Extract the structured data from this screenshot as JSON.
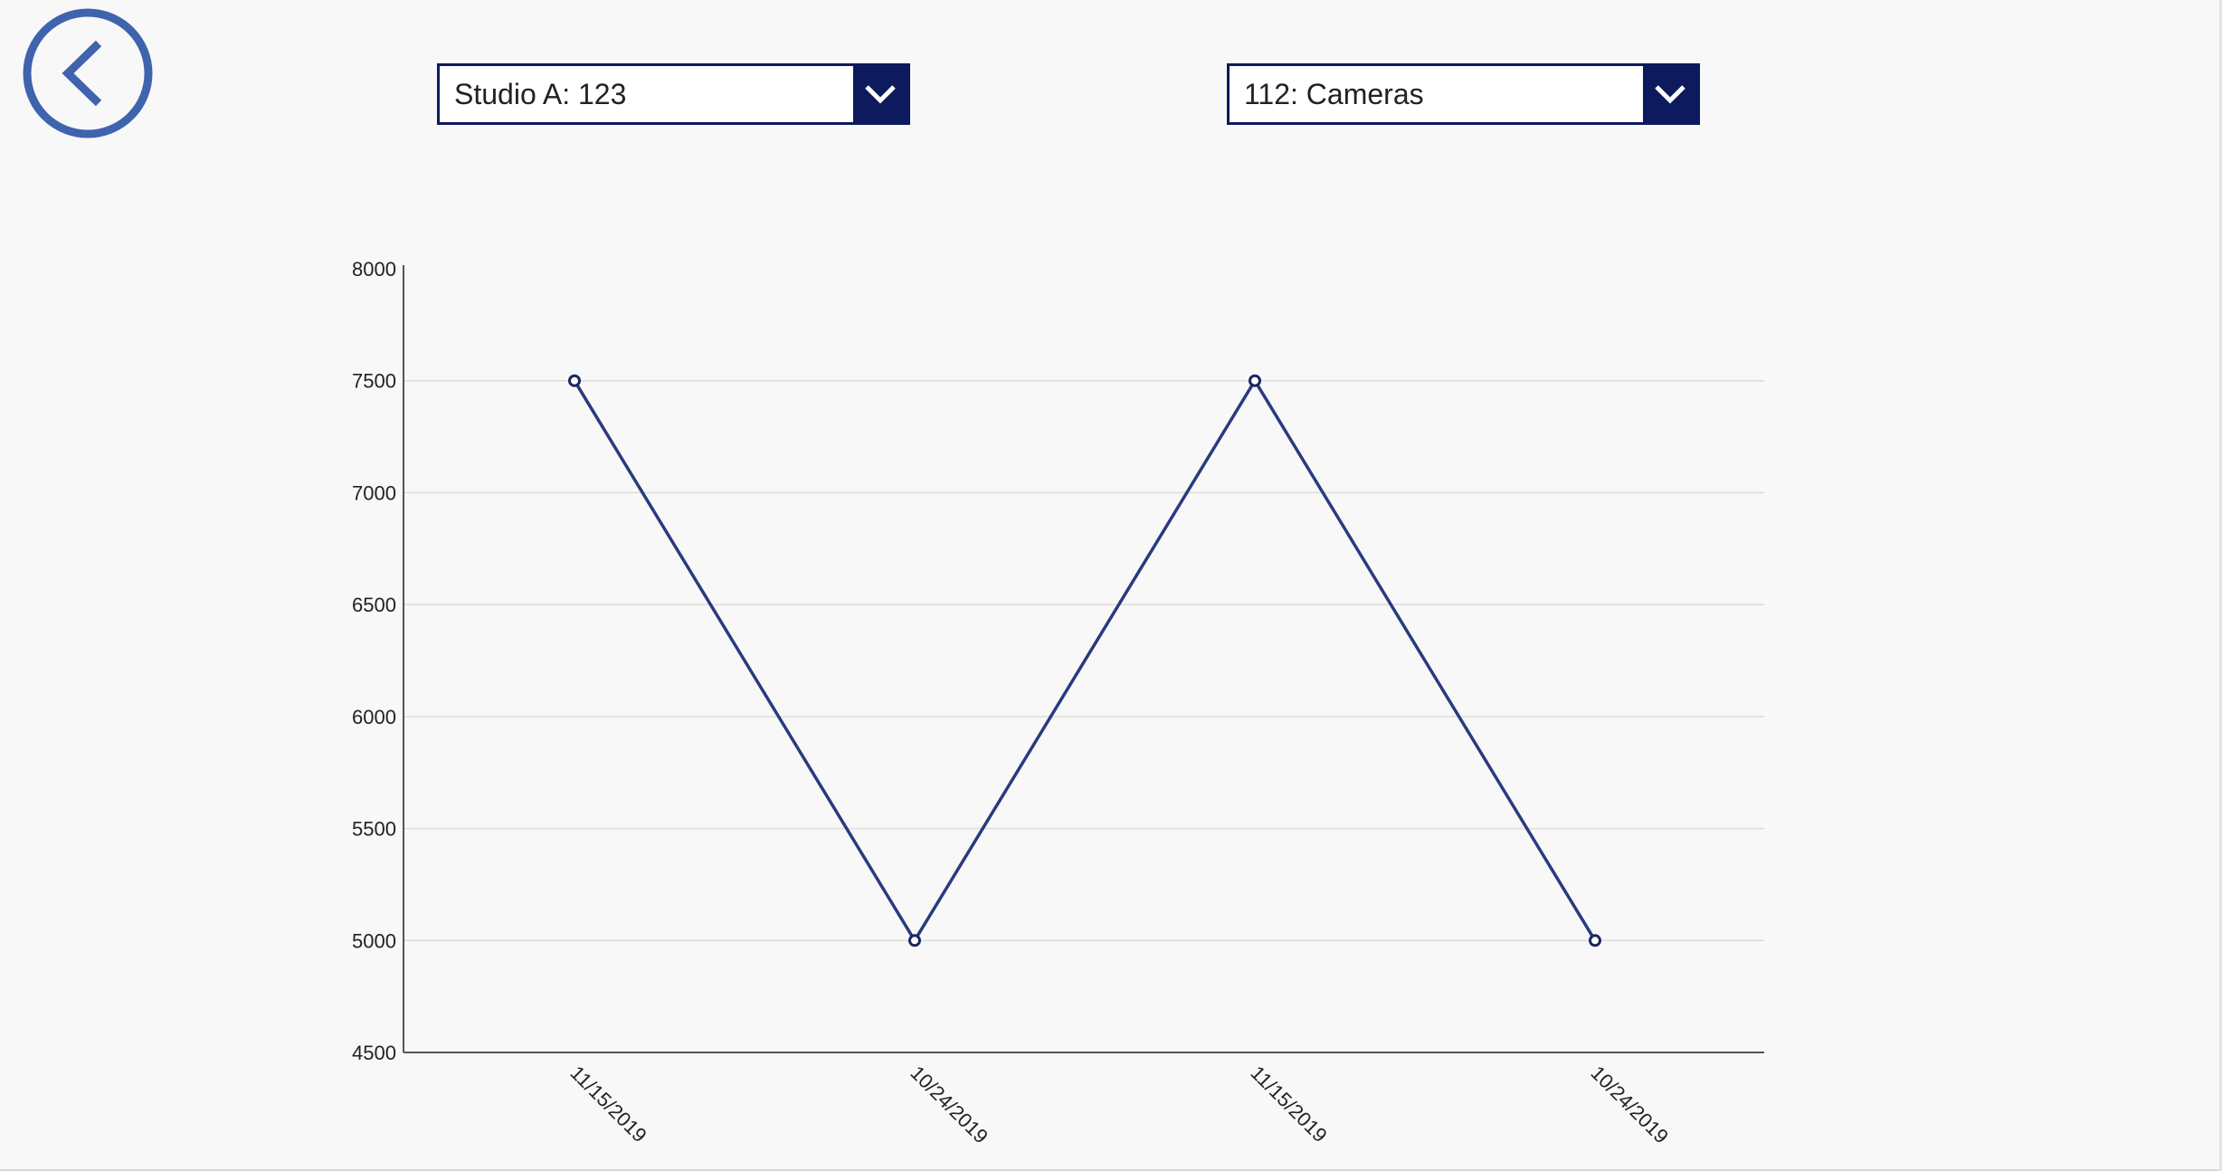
{
  "back_button": {
    "icon": "chevron-left-icon",
    "color": "#3f63ad"
  },
  "dropdowns": {
    "studio": {
      "value": "Studio A: 123",
      "icon": "chevron-down-icon"
    },
    "category": {
      "value": "112: Cameras",
      "icon": "chevron-down-icon"
    }
  },
  "colors": {
    "accent": "#0d1a5e",
    "line": "#2b3a7e",
    "back_icon": "#3f63ad",
    "grid": "#dcdcdc"
  },
  "chart_data": {
    "type": "line",
    "categories": [
      "11/15/2019",
      "10/24/2019",
      "11/15/2019",
      "10/24/2019"
    ],
    "series": [
      {
        "values": [
          7500,
          5000,
          7500,
          5000
        ]
      }
    ],
    "yticks": [
      4500,
      5000,
      5500,
      6000,
      6500,
      7000,
      7500,
      8000
    ],
    "ylim": [
      4500,
      8000
    ],
    "grid": true,
    "xlabel": "",
    "ylabel": "",
    "title": ""
  }
}
